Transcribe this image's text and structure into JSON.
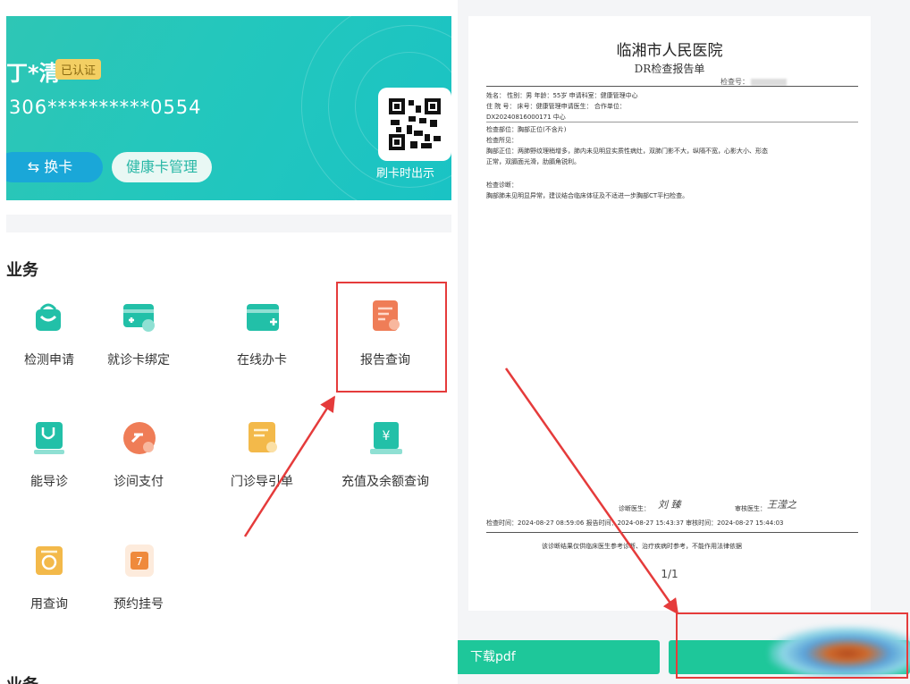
{
  "card": {
    "holder_name": "丁*清",
    "verified_badge": "已认证",
    "card_number": "306**********0554",
    "switch_button": "换卡",
    "manage_button": "健康卡管理",
    "qr_label": "刷卡时出示"
  },
  "services": {
    "section_title": "业务",
    "items": [
      {
        "label": "检测申请",
        "icon": "bag-icon",
        "color": "#22c0a8"
      },
      {
        "label": "就诊卡绑定",
        "icon": "card-link-icon",
        "color": "#22c0a8"
      },
      {
        "label": "在线办卡",
        "icon": "add-card-icon",
        "color": "#22c0a8"
      },
      {
        "label": "报告查询",
        "icon": "report-search-icon",
        "color": "#ef7d57"
      },
      {
        "label": "能导诊",
        "icon": "stethoscope-icon",
        "color": "#22c0a8"
      },
      {
        "label": "诊间支付",
        "icon": "payment-icon",
        "color": "#ef7d57"
      },
      {
        "label": "门诊导引单",
        "icon": "guide-sheet-icon",
        "color": "#f3b94a"
      },
      {
        "label": "充值及余额查询",
        "icon": "recharge-icon",
        "color": "#22c0a8"
      },
      {
        "label": "用查询",
        "icon": "fee-query-icon",
        "color": "#f3b94a"
      },
      {
        "label": "预约挂号",
        "icon": "appointment-icon",
        "color": "#ef8a3c"
      }
    ],
    "second_section_title": "业务"
  },
  "report": {
    "hospital": "临湘市人民医院",
    "title": "DR检查报告单",
    "exam_no_label": "检查号：",
    "row1": "姓名：        性别：男      年龄：55岁       申请科室：健康管理中心",
    "row2": "住 院 号：        床号：健康管理申请医生：       合作单位：",
    "row3": "DX20240816000171      中心",
    "part": "检查部位：胸部正位(不含片)",
    "findings_label": "检查所见：",
    "findings_1": "胸部正位：两肺野纹理稍增多，肺内未见明显实质性病灶，双肺门影不大，纵隔不宽，心影大小、形态",
    "findings_2": "正常，双膈面光滑，肋膈角锐利。",
    "diagnosis_label": "检查诊断：",
    "diagnosis": "胸部肺未见明显异常，建议结合临床体征及不适进一步胸部CT平扫检查。",
    "signer_label": "诊断医生：",
    "reviewer_label": "审核医生：",
    "signer_sign": "刘 臻",
    "reviewer_sign": "王滢之",
    "times": "检查时间：2024-08-27 08:59:06   报告时间：2024-08-27 15:43:37   审核时间：2024-08-27 15:44:03",
    "disclaimer": "该诊断结果仅供临床医生参考诊断、治疗疾病时参考，不能作用法律依据",
    "page": "1/1"
  },
  "actions": {
    "download_pdf": "下载pdf"
  },
  "colors": {
    "accent": "#1ec79a",
    "highlight": "#e53b3b",
    "card_gradient_start": "#2ec6b5"
  }
}
